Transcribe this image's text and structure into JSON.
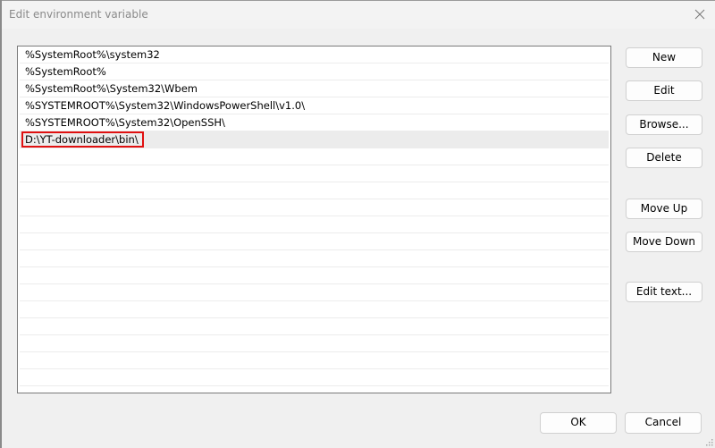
{
  "window": {
    "title": "Edit environment variable",
    "close_icon": "close-icon"
  },
  "list": {
    "items": [
      "%SystemRoot%\\system32",
      "%SystemRoot%",
      "%SystemRoot%\\System32\\Wbem",
      "%SYSTEMROOT%\\System32\\WindowsPowerShell\\v1.0\\",
      "%SYSTEMROOT%\\System32\\OpenSSH\\",
      "D:\\YT-downloader\\bin\\"
    ],
    "selected_index": 5,
    "highlight_color": "#e01010"
  },
  "buttons": {
    "new": "New",
    "edit": "Edit",
    "browse": "Browse...",
    "delete": "Delete",
    "move_up": "Move Up",
    "move_down": "Move Down",
    "edit_text": "Edit text...",
    "ok": "OK",
    "cancel": "Cancel"
  }
}
